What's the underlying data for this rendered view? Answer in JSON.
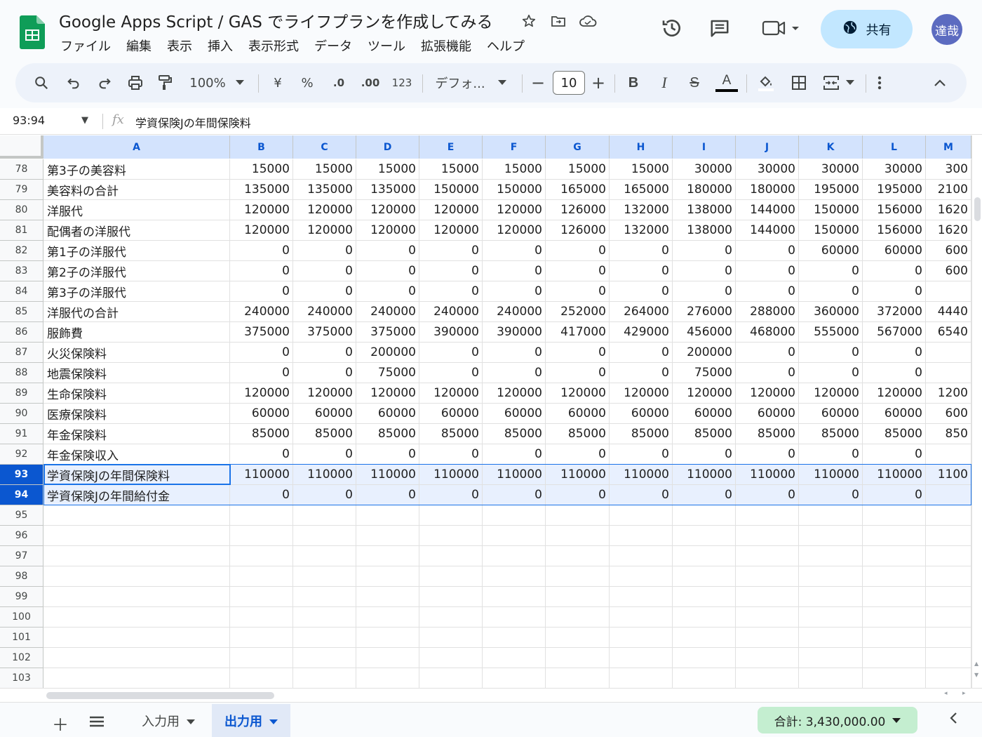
{
  "header": {
    "title": "Google Apps Script / GAS でライフプランを作成してみる",
    "menu": [
      "ファイル",
      "編集",
      "表示",
      "挿入",
      "表示形式",
      "データ",
      "ツール",
      "拡張機能",
      "ヘルプ"
    ],
    "share_label": "共有",
    "avatar_text": "達哉",
    "icons": [
      "star-icon",
      "move-to-folder-icon",
      "cloud-saved-icon",
      "history-icon",
      "comment-icon",
      "meet-icon",
      "globe-icon"
    ]
  },
  "toolbar": {
    "zoom": "100%",
    "currency": "¥",
    "percent": "%",
    "dec_decrease": ".0",
    "dec_increase": ".00",
    "number_format": "123",
    "font": "デフォ...",
    "font_size": "10",
    "bold": "B",
    "italic": "I",
    "strike": "S",
    "text_color": "A"
  },
  "formula_bar": {
    "name_box": "93:94",
    "fx": "fx",
    "content": "学資保険Jの年間保険料"
  },
  "columns": [
    "A",
    "B",
    "C",
    "D",
    "E",
    "F",
    "G",
    "H",
    "I",
    "J",
    "K",
    "L",
    "M"
  ],
  "rows": [
    {
      "num": "78",
      "label": "第3子の美容料",
      "values": [
        "15000",
        "15000",
        "15000",
        "15000",
        "15000",
        "15000",
        "15000",
        "30000",
        "30000",
        "30000",
        "30000",
        "300"
      ]
    },
    {
      "num": "79",
      "label": "美容料の合計",
      "values": [
        "135000",
        "135000",
        "135000",
        "150000",
        "150000",
        "165000",
        "165000",
        "180000",
        "180000",
        "195000",
        "195000",
        "2100"
      ]
    },
    {
      "num": "80",
      "label": "洋服代",
      "values": [
        "120000",
        "120000",
        "120000",
        "120000",
        "120000",
        "126000",
        "132000",
        "138000",
        "144000",
        "150000",
        "156000",
        "1620"
      ]
    },
    {
      "num": "81",
      "label": "配偶者の洋服代",
      "values": [
        "120000",
        "120000",
        "120000",
        "120000",
        "120000",
        "126000",
        "132000",
        "138000",
        "144000",
        "150000",
        "156000",
        "1620"
      ]
    },
    {
      "num": "82",
      "label": "第1子の洋服代",
      "values": [
        "0",
        "0",
        "0",
        "0",
        "0",
        "0",
        "0",
        "0",
        "0",
        "60000",
        "60000",
        "600"
      ]
    },
    {
      "num": "83",
      "label": "第2子の洋服代",
      "values": [
        "0",
        "0",
        "0",
        "0",
        "0",
        "0",
        "0",
        "0",
        "0",
        "0",
        "0",
        "600"
      ]
    },
    {
      "num": "84",
      "label": "第3子の洋服代",
      "values": [
        "0",
        "0",
        "0",
        "0",
        "0",
        "0",
        "0",
        "0",
        "0",
        "0",
        "0",
        ""
      ]
    },
    {
      "num": "85",
      "label": "洋服代の合計",
      "values": [
        "240000",
        "240000",
        "240000",
        "240000",
        "240000",
        "252000",
        "264000",
        "276000",
        "288000",
        "360000",
        "372000",
        "4440"
      ]
    },
    {
      "num": "86",
      "label": "服飾費",
      "values": [
        "375000",
        "375000",
        "375000",
        "390000",
        "390000",
        "417000",
        "429000",
        "456000",
        "468000",
        "555000",
        "567000",
        "6540"
      ]
    },
    {
      "num": "87",
      "label": "火災保険料",
      "values": [
        "0",
        "0",
        "200000",
        "0",
        "0",
        "0",
        "0",
        "200000",
        "0",
        "0",
        "0",
        ""
      ]
    },
    {
      "num": "88",
      "label": "地震保険料",
      "values": [
        "0",
        "0",
        "75000",
        "0",
        "0",
        "0",
        "0",
        "75000",
        "0",
        "0",
        "0",
        ""
      ]
    },
    {
      "num": "89",
      "label": "生命保険料",
      "values": [
        "120000",
        "120000",
        "120000",
        "120000",
        "120000",
        "120000",
        "120000",
        "120000",
        "120000",
        "120000",
        "120000",
        "1200"
      ]
    },
    {
      "num": "90",
      "label": "医療保険料",
      "values": [
        "60000",
        "60000",
        "60000",
        "60000",
        "60000",
        "60000",
        "60000",
        "60000",
        "60000",
        "60000",
        "60000",
        "600"
      ]
    },
    {
      "num": "91",
      "label": "年金保険料",
      "values": [
        "85000",
        "85000",
        "85000",
        "85000",
        "85000",
        "85000",
        "85000",
        "85000",
        "85000",
        "85000",
        "85000",
        "850"
      ]
    },
    {
      "num": "92",
      "label": "年金保険収入",
      "values": [
        "0",
        "0",
        "0",
        "0",
        "0",
        "0",
        "0",
        "0",
        "0",
        "0",
        "0",
        ""
      ]
    },
    {
      "num": "93",
      "label": "学資保険Jの年間保険料",
      "values": [
        "110000",
        "110000",
        "110000",
        "110000",
        "110000",
        "110000",
        "110000",
        "110000",
        "110000",
        "110000",
        "110000",
        "1100"
      ],
      "selected": true
    },
    {
      "num": "94",
      "label": "学資保険Jの年間給付金",
      "values": [
        "0",
        "0",
        "0",
        "0",
        "0",
        "0",
        "0",
        "0",
        "0",
        "0",
        "0",
        ""
      ],
      "selected": true
    },
    {
      "num": "95",
      "label": "",
      "values": []
    },
    {
      "num": "96",
      "label": "",
      "values": []
    },
    {
      "num": "97",
      "label": "",
      "values": []
    },
    {
      "num": "98",
      "label": "",
      "values": []
    },
    {
      "num": "99",
      "label": "",
      "values": []
    },
    {
      "num": "100",
      "label": "",
      "values": []
    },
    {
      "num": "101",
      "label": "",
      "values": []
    },
    {
      "num": "102",
      "label": "",
      "values": []
    },
    {
      "num": "103",
      "label": "",
      "values": []
    }
  ],
  "sheets": [
    {
      "name": "入力用",
      "active": false
    },
    {
      "name": "出力用",
      "active": true
    }
  ],
  "status": {
    "sum": "合計: 3,430,000.00"
  },
  "colors": {
    "accent": "#0b57d0",
    "share_bg": "#c2e7ff",
    "sum_bg": "#c4eed0",
    "selection_bg": "#e8f0fe"
  }
}
